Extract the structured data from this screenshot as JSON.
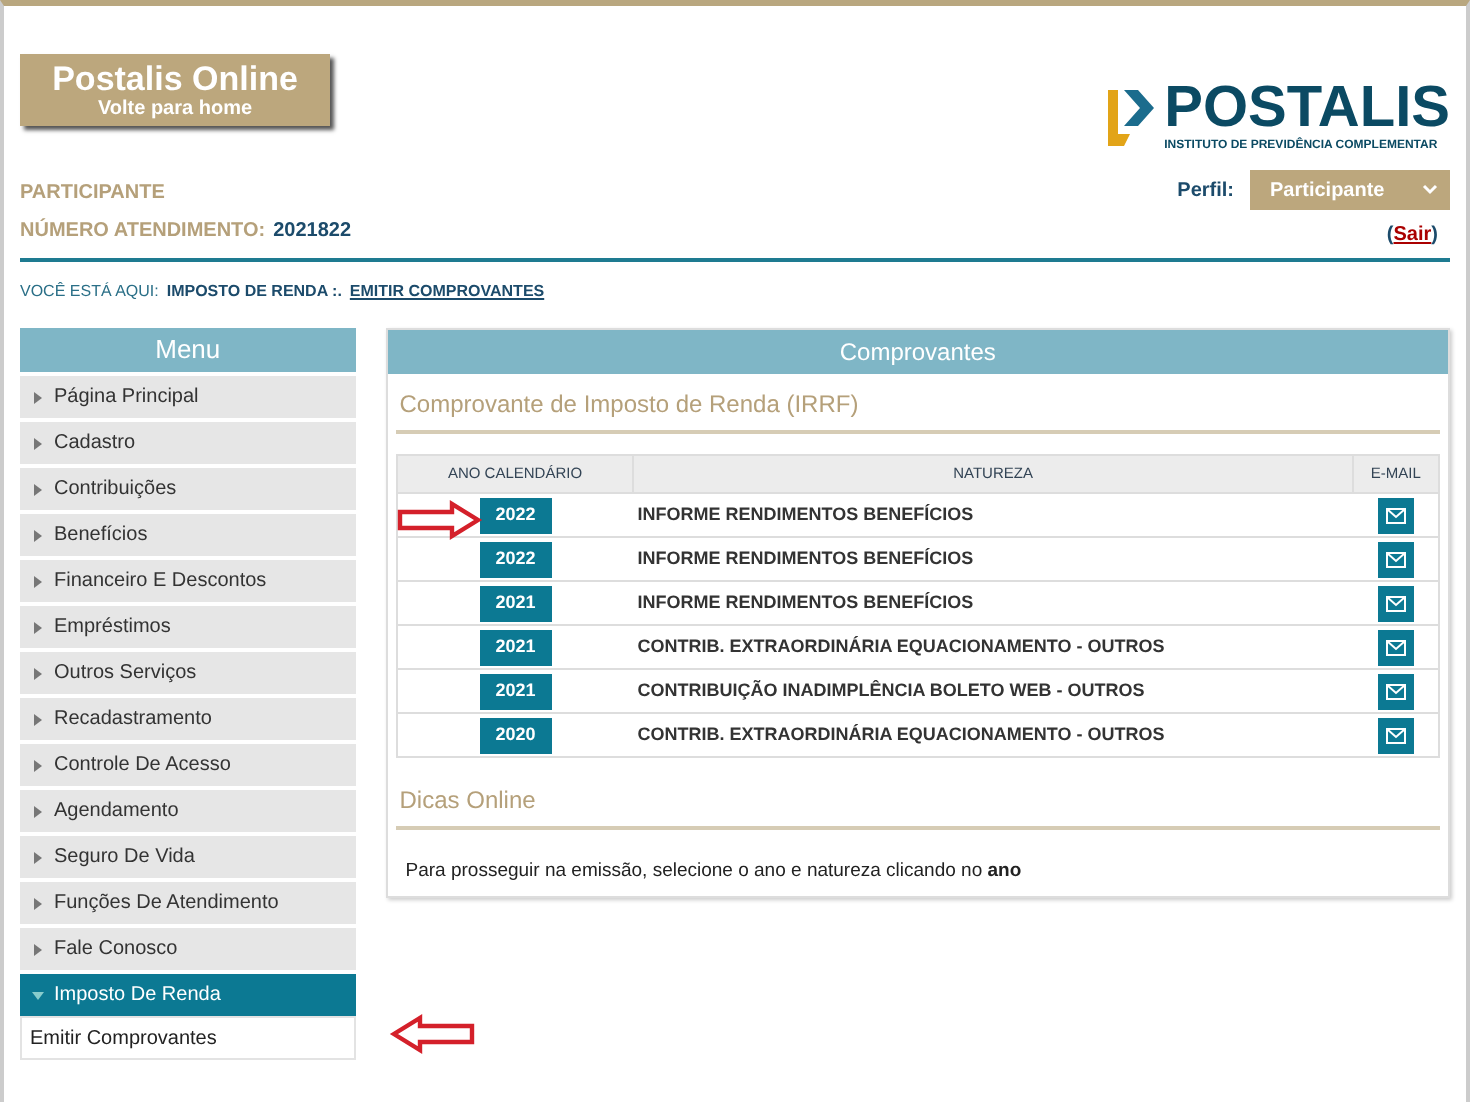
{
  "header": {
    "home_button": {
      "title": "Postalis Online",
      "subtitle": "Volte para home"
    },
    "logo": {
      "name": "POSTALIS",
      "tagline": "INSTITUTO DE PREVIDÊNCIA COMPLEMENTAR"
    }
  },
  "user": {
    "role": "PARTICIPANTE",
    "number_label": "NÚMERO ATENDIMENTO:",
    "number": "2021822",
    "profile_label": "Perfil:",
    "profile": "Participante",
    "logout": "Sair",
    "logout_open": "(",
    "logout_close": ")"
  },
  "breadcrumb": {
    "label": "VOCÊ ESTÁ AQUI:",
    "path": "IMPOSTO DE RENDA :.",
    "current": "EMITIR COMPROVANTES"
  },
  "menu": {
    "title": "Menu",
    "items": [
      {
        "label": "Página Principal",
        "expanded": false
      },
      {
        "label": "Cadastro",
        "expanded": false
      },
      {
        "label": "Contribuições",
        "expanded": false
      },
      {
        "label": "Benefícios",
        "expanded": false
      },
      {
        "label": "Financeiro E Descontos",
        "expanded": false
      },
      {
        "label": "Empréstimos",
        "expanded": false
      },
      {
        "label": "Outros Serviços",
        "expanded": false
      },
      {
        "label": "Recadastramento",
        "expanded": false
      },
      {
        "label": "Controle De Acesso",
        "expanded": false
      },
      {
        "label": "Agendamento",
        "expanded": false
      },
      {
        "label": "Seguro De Vida",
        "expanded": false
      },
      {
        "label": "Funções De Atendimento",
        "expanded": false
      },
      {
        "label": "Fale Conosco",
        "expanded": false
      },
      {
        "label": "Imposto De Renda",
        "expanded": true,
        "children": [
          {
            "label": "Emitir Comprovantes"
          }
        ]
      }
    ]
  },
  "panel": {
    "title": "Comprovantes",
    "section": "Comprovante de Imposto de Renda (IRRF)",
    "table": {
      "columns": [
        "ANO CALENDÁRIO",
        "NATUREZA",
        "E-MAIL"
      ],
      "rows": [
        {
          "year": "2022",
          "nature": "INFORME RENDIMENTOS BENEFÍCIOS"
        },
        {
          "year": "2022",
          "nature": "INFORME RENDIMENTOS BENEFÍCIOS"
        },
        {
          "year": "2021",
          "nature": "INFORME RENDIMENTOS BENEFÍCIOS"
        },
        {
          "year": "2021",
          "nature": "CONTRIB. EXTRAORDINÁRIA EQUACIONAMENTO - OUTROS"
        },
        {
          "year": "2021",
          "nature": "CONTRIBUIÇÃO INADIMPLÊNCIA BOLETO WEB - OUTROS"
        },
        {
          "year": "2020",
          "nature": "CONTRIB. EXTRAORDINÁRIA EQUACIONAMENTO - OUTROS"
        }
      ]
    },
    "tips_title": "Dicas Online",
    "tips": "Para prosseguir na emissão, selecione o ano e natureza clicando no **ano**"
  }
}
